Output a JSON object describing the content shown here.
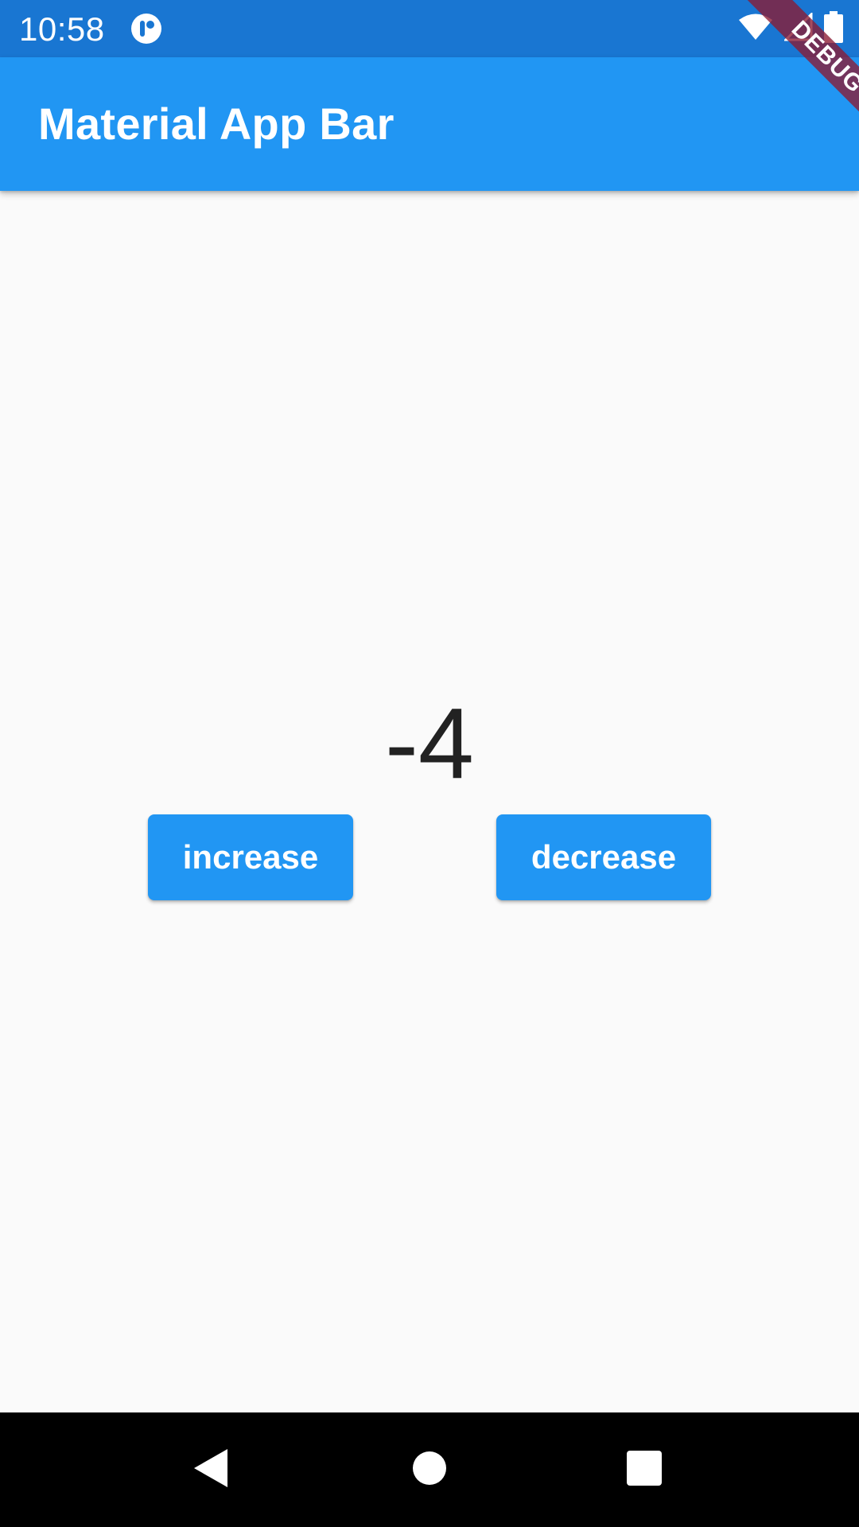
{
  "status_bar": {
    "time": "10:58",
    "app_icon": "notification-app-icon",
    "icons": [
      "wifi-icon",
      "cell-signal-icon",
      "battery-icon"
    ],
    "color": "#1976d2"
  },
  "app_bar": {
    "title": "Material App Bar",
    "color": "#2196f3"
  },
  "debug_banner": {
    "label": "DEBUG"
  },
  "counter": {
    "value": "-4"
  },
  "buttons": {
    "increase_label": "increase",
    "decrease_label": "decrease",
    "color": "#2196f3"
  },
  "nav_bar": {
    "icons": [
      "back-icon",
      "home-icon",
      "recents-icon"
    ]
  }
}
